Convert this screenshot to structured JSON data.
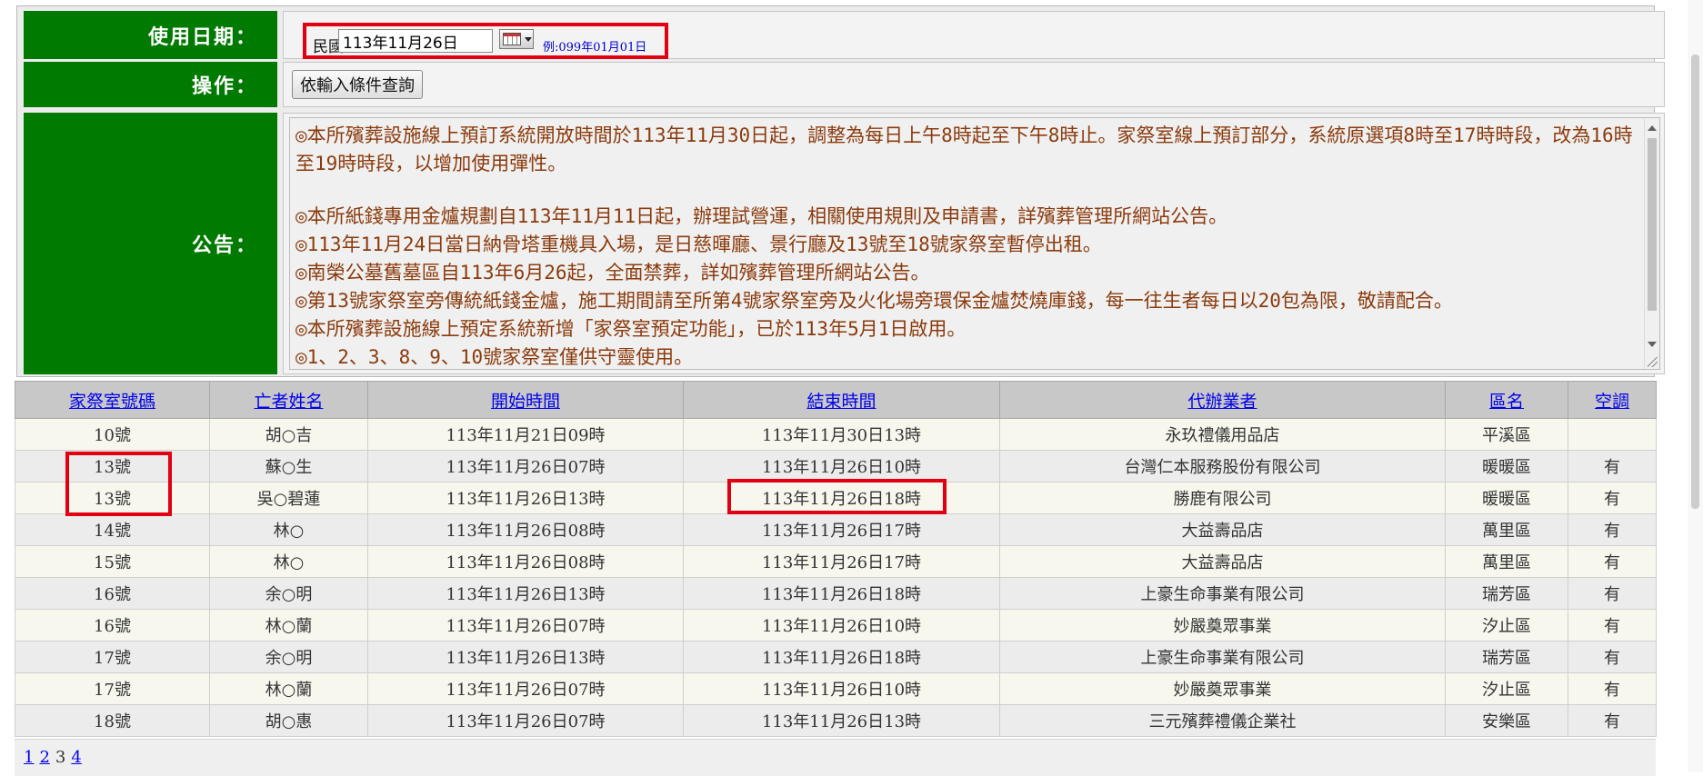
{
  "form": {
    "date_label": "使用日期：",
    "era_label": "民國",
    "date_value": "113年11月26日",
    "date_example": "例:099年01月01日",
    "operation_label": "操作：",
    "query_button": "依輸入條件查詢",
    "notice_label": "公告："
  },
  "notices": [
    "◎本所殯葬設施線上預訂系統開放時間於113年11月30日起，調整為每日上午8時起至下午8時止。家祭室線上預訂部分，系統原選項8時至17時時段，改為16時至19時時段，以增加使用彈性。",
    "◎本所紙錢專用金爐規劃自113年11月11日起，辦理試營運，相關使用規則及申請書，詳殯葬管理所網站公告。",
    "◎113年11月24日當日納骨塔重機具入場，是日慈暉廳、景行廳及13號至18號家祭室暫停出租。",
    "◎南榮公墓舊墓區自113年6月26起，全面禁葬，詳如殯葬管理所網站公告。",
    "◎第13號家祭室旁傳統紙錢金爐，施工期間請至所第4號家祭室旁及火化場旁環保金爐焚燒庫錢，每一往生者每日以20包為限，敬請配合。",
    "◎本所殯葬設施線上預定系統新增「家祭室預定功能」，已於113年5月1日啟用。",
    "◎1、2、3、8、9、10號家祭室僅供守靈使用。"
  ],
  "table": {
    "headers": [
      "家祭室號碼",
      "亡者姓名",
      "開始時間",
      "結束時間",
      "代辦業者",
      "區名",
      "空調"
    ],
    "rows": [
      [
        "10號",
        "胡○吉",
        "113年11月21日09時",
        "113年11月30日13時",
        "永玖禮儀用品店",
        "平溪區",
        ""
      ],
      [
        "13號",
        "蘇○生",
        "113年11月26日07時",
        "113年11月26日10時",
        "台灣仁本服務股份有限公司",
        "暖暖區",
        "有"
      ],
      [
        "13號",
        "吳○碧蓮",
        "113年11月26日13時",
        "113年11月26日18時",
        "勝鹿有限公司",
        "暖暖區",
        "有"
      ],
      [
        "14號",
        "林○",
        "113年11月26日08時",
        "113年11月26日17時",
        "大益壽品店",
        "萬里區",
        "有"
      ],
      [
        "15號",
        "林○",
        "113年11月26日08時",
        "113年11月26日17時",
        "大益壽品店",
        "萬里區",
        "有"
      ],
      [
        "16號",
        "余○明",
        "113年11月26日13時",
        "113年11月26日18時",
        "上豪生命事業有限公司",
        "瑞芳區",
        "有"
      ],
      [
        "16號",
        "林○蘭",
        "113年11月26日07時",
        "113年11月26日10時",
        "妙嚴奠眾事業",
        "汐止區",
        "有"
      ],
      [
        "17號",
        "余○明",
        "113年11月26日13時",
        "113年11月26日18時",
        "上豪生命事業有限公司",
        "瑞芳區",
        "有"
      ],
      [
        "17號",
        "林○蘭",
        "113年11月26日07時",
        "113年11月26日10時",
        "妙嚴奠眾事業",
        "汐止區",
        "有"
      ],
      [
        "18號",
        "胡○惠",
        "113年11月26日07時",
        "113年11月26日13時",
        "三元殯葬禮儀企業社",
        "安樂區",
        "有"
      ]
    ]
  },
  "pager": {
    "pages": [
      "1",
      "2",
      "3",
      "4"
    ],
    "current": "3"
  },
  "colors": {
    "label_green": "#007a00",
    "notice_text": "#8b3a0c",
    "highlight_red": "#e00012",
    "link_blue": "#0000ee"
  }
}
